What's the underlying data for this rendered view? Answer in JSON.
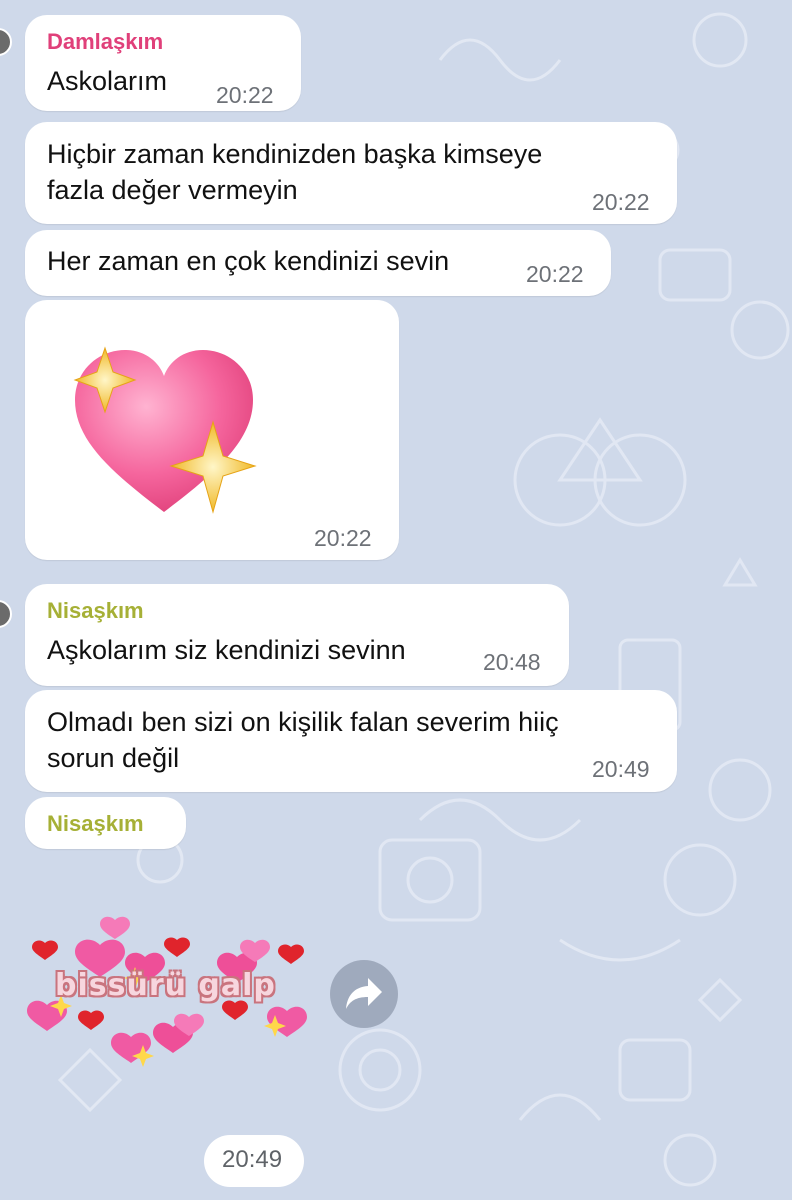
{
  "messages": [
    {
      "sender": "Damlaşkım",
      "text": "Askolarım",
      "time": "20:22"
    },
    {
      "lines": [
        "Hiçbir zaman kendinizden başka kimseye",
        "fazla değer vermeyin"
      ],
      "time": "20:22"
    },
    {
      "text": "Her zaman en çok kendinizi sevin",
      "time": "20:22"
    },
    {
      "sticker": "sparkling-heart",
      "time": "20:22"
    },
    {
      "sender": "Nisaşkım",
      "text": "Aşkolarım siz kendinizi sevinn",
      "time": "20:48"
    },
    {
      "lines": [
        "Olmadı ben sizi on kişilik falan severim hiiç",
        "sorun değil"
      ],
      "time": "20:49"
    },
    {
      "sender": "Nisaşkım"
    }
  ],
  "sticker_hearts": {
    "caption": "bissürü galp",
    "icon": "hearts-sticker"
  },
  "forward": {
    "icon": "forward-arrow-icon"
  },
  "last_time": "20:49",
  "colors": {
    "sender1": "#e0407a",
    "sender2": "#a6b036",
    "bubble": "#ffffff",
    "background": "#cfd9ea",
    "time": "#6d7177"
  }
}
